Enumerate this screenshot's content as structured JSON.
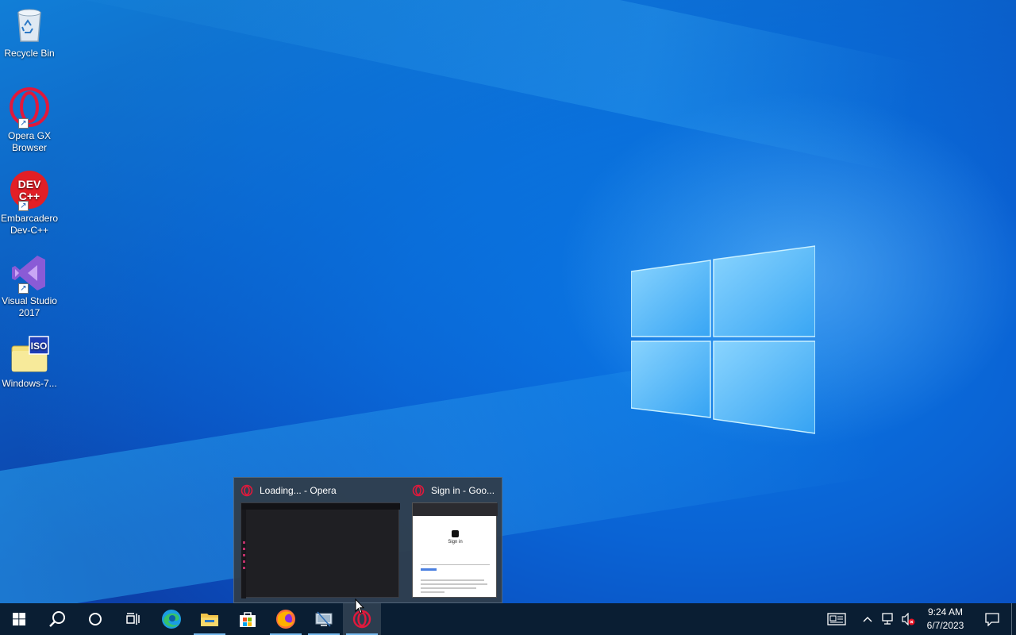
{
  "desktop": {
    "icons": [
      {
        "label": "Recycle Bin",
        "icon": "recycle-bin-icon"
      },
      {
        "label": "Opera GX Browser",
        "icon": "opera-gx-icon"
      },
      {
        "label": "Embarcadero Dev-C++",
        "icon": "dev-cpp-icon"
      },
      {
        "label": "Visual Studio 2017",
        "icon": "visual-studio-icon"
      },
      {
        "label": "Windows-7...",
        "icon": "iso-file-icon"
      }
    ],
    "dev_cpp_logo_text": "DEV C++",
    "iso_logo_text": "ISO"
  },
  "preview": {
    "windows": [
      {
        "title": "Loading... - Opera"
      },
      {
        "title": "Sign in - Goo..."
      }
    ],
    "signin_thumb": {
      "heading": "Sign in"
    }
  },
  "taskbar": {
    "buttons": [
      {
        "name": "start-button",
        "icon": "windows-icon"
      },
      {
        "name": "search-button",
        "icon": "search-icon"
      },
      {
        "name": "cortana-button",
        "icon": "cortana-circle-icon"
      },
      {
        "name": "task-view-button",
        "icon": "task-view-icon"
      },
      {
        "name": "edge-button",
        "icon": "edge-icon"
      },
      {
        "name": "file-explorer-button",
        "icon": "folder-icon"
      },
      {
        "name": "store-button",
        "icon": "store-icon"
      },
      {
        "name": "firefox-button",
        "icon": "firefox-icon"
      },
      {
        "name": "network-app-button",
        "icon": "network-computer-icon"
      },
      {
        "name": "opera-button",
        "icon": "opera-icon"
      }
    ],
    "clock": {
      "time": "9:24 AM",
      "date": "6/7/2023"
    }
  },
  "colors": {
    "taskbar": "#0a1e33",
    "opera_red": "#e0193c",
    "accent": "#76b9ed"
  }
}
